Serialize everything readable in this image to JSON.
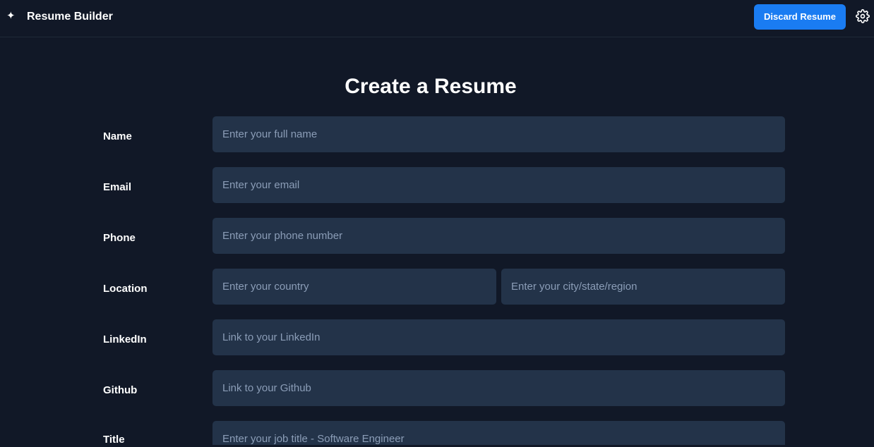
{
  "header": {
    "brand_icon": "sparkle-icon",
    "title": "Resume Builder",
    "discard_label": "Discard Resume",
    "settings_icon": "gear-icon"
  },
  "page": {
    "title": "Create a Resume"
  },
  "form": {
    "name": {
      "label": "Name",
      "placeholder": "Enter your full name",
      "value": ""
    },
    "email": {
      "label": "Email",
      "placeholder": "Enter your email",
      "value": ""
    },
    "phone": {
      "label": "Phone",
      "placeholder": "Enter your phone number",
      "value": ""
    },
    "location": {
      "label": "Location",
      "country_placeholder": "Enter your country",
      "city_placeholder": "Enter your city/state/region"
    },
    "linkedin": {
      "label": "LinkedIn",
      "placeholder": "Link to your LinkedIn",
      "value": ""
    },
    "github": {
      "label": "Github",
      "placeholder": "Link to your Github",
      "value": ""
    },
    "title": {
      "label": "Title",
      "placeholder": "Enter your job title - Software Engineer",
      "value": ""
    }
  },
  "colors": {
    "background": "#111827",
    "input_background": "#233349",
    "accent": "#1a7cf2",
    "placeholder": "#8b9db7"
  }
}
